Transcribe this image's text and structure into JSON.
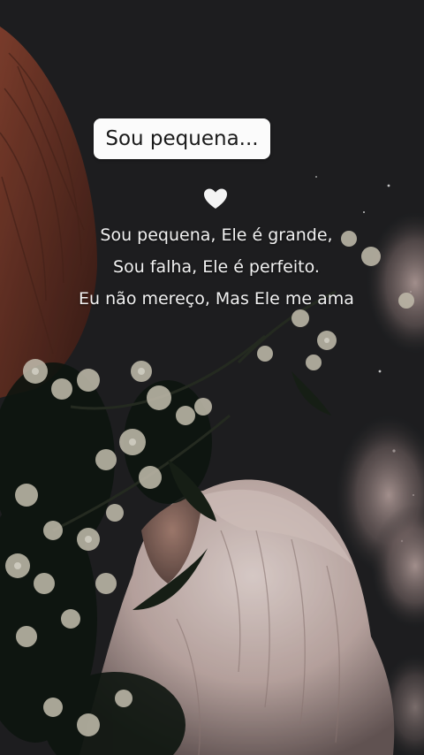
{
  "title": "Sou pequena...",
  "icon": "white-heart-icon",
  "quote_lines": [
    "Sou pequena, Ele é grande,",
    "Sou falha, Ele é perfeito.",
    "Eu não mereço, Mas Ele me ama"
  ],
  "colors": {
    "sky": "#1e2022",
    "text": "#f1f1f1",
    "pill": "#fbfbfb",
    "hat": "#6a3325"
  }
}
